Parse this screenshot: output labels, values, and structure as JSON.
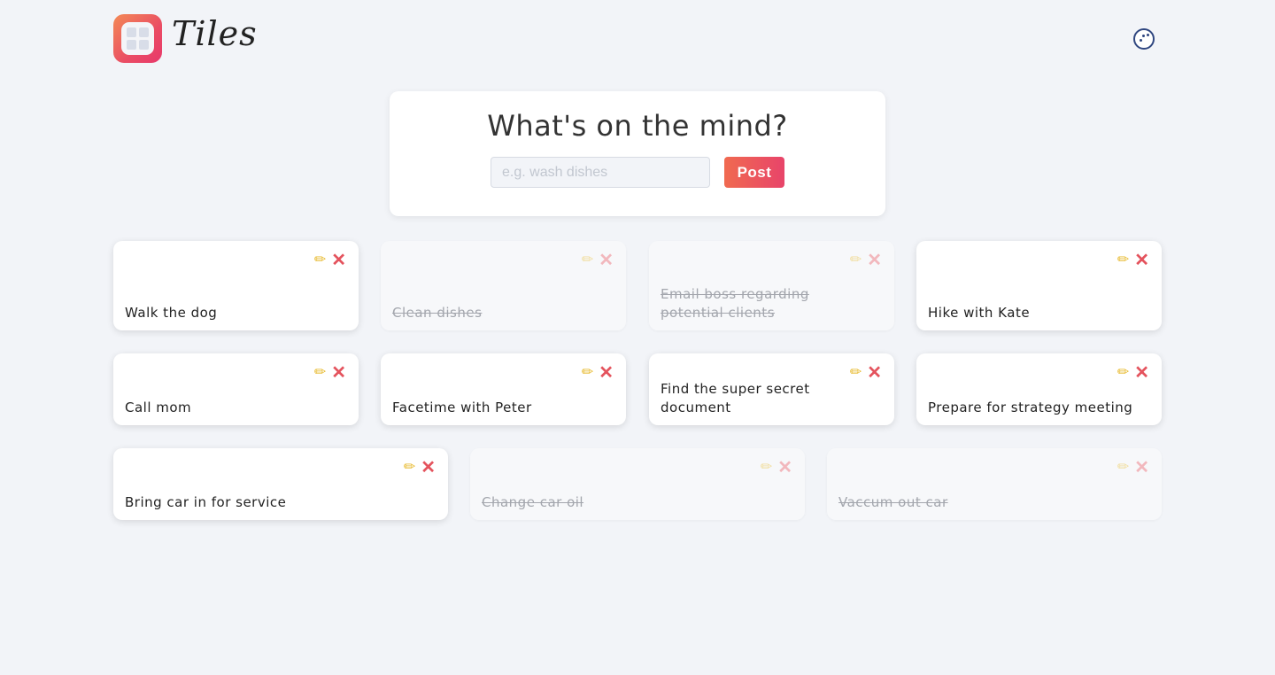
{
  "app": {
    "title": "Tiles",
    "logo_icon": "grid-icon",
    "theme_toggle_icon": "moon-face-icon"
  },
  "composer": {
    "heading": "What's on the mind?",
    "placeholder": "e.g. wash dishes",
    "value": "",
    "post_label": "Post"
  },
  "icons": {
    "edit": "pencil-icon",
    "delete": "close-icon"
  },
  "colors": {
    "background": "#f2f4f8",
    "accent_start": "#f06a50",
    "accent_end": "#e8446a",
    "edit_icon": "#e7b829",
    "delete_icon": "#e4535d"
  },
  "tiles": [
    {
      "text": "Walk the dog",
      "completed": false
    },
    {
      "text": "Clean dishes",
      "completed": true
    },
    {
      "text": "Email boss regarding potential clients",
      "completed": true
    },
    {
      "text": "Hike with Kate",
      "completed": false
    },
    {
      "text": "Call mom",
      "completed": false
    },
    {
      "text": "Facetime with Peter",
      "completed": false
    },
    {
      "text": "Find the super secret document",
      "completed": false
    },
    {
      "text": "Prepare for strategy meeting",
      "completed": false
    },
    {
      "text": "Bring car in for service",
      "completed": false
    },
    {
      "text": "Change car oil",
      "completed": true
    },
    {
      "text": "Vaccum out car",
      "completed": true
    }
  ]
}
